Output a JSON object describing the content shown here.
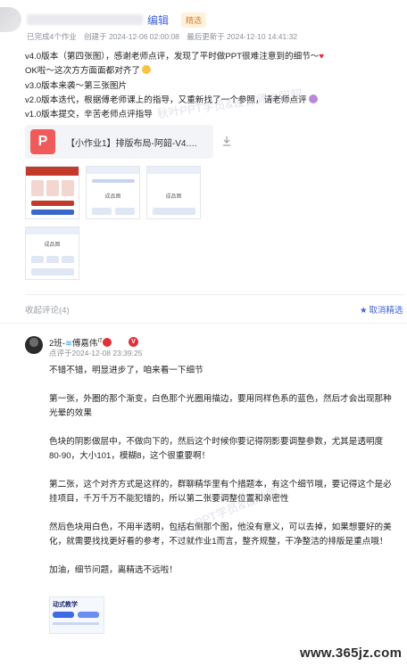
{
  "post": {
    "edit_label": "编辑",
    "featured_badge": "精选",
    "meta": {
      "works_count": "已完成4个作业",
      "created": "创建于 2024-12-06 02:00:08",
      "updated": "最后更新于 2024-12-10 14:41:32"
    },
    "changelog": [
      "v4.0版本（第四张图），感谢老师点评，发现了平时做PPT很难注意到的细节～",
      "OK啦～这次方方面面都对齐了",
      "v3.0版本来袭～第三张图片",
      "v2.0版本迭代，根据傅老师课上的指导，又重新找了一个参照，请老师点评",
      "v1.0版本提交，辛苦老师点评指导"
    ],
    "attachment": {
      "icon": "ppt-file-icon",
      "icon_letter": "P",
      "filename": "【小作业1】排版布局-阿韶-V4.0...."
    },
    "thumbnails": [
      "成品图",
      "成品图",
      "成品图"
    ],
    "watermark": "秋叶PPT学员&设计师@阿韶"
  },
  "comments": {
    "label": "收起评论(4)",
    "unstar_label": "取消精选",
    "items": [
      {
        "author": "2班-",
        "author_suffix": "傅嘉伟",
        "author_tag": "IT",
        "badge": "V",
        "time": "点评于2024-12-08 23:39:25",
        "paragraphs": [
          "不错不错，明显进步了，咱来看一下细节",
          "第一张，外圈的那个渐变，白色那个光圈用描边，要用同样色系的蓝色，然后才会出现那种光晕的效果",
          "色块的阴影做层中，不做向下的，然后这个时候你要记得阴影要调整参数，尤其是透明度80-90，大小101，模糊8，这个很重要啊！",
          "第二张，这个对齐方式是这样的，群聊精华里有个措题本，有这个细节哦，要记得这个是必挂项目，千万千万不能犯错的，所以第二张要调整位置和亲密性",
          "然后色块用白色，不用半透明，包括右侧那个图，他没有意义，可以去掉，如果想要好的美化，就需要找找更好看的参考，不过就作业1而言，整齐规整，干净整洁的排版是重点哦！",
          "加油，细节问题，离精选不远啦！"
        ],
        "attachment_title": "动式教学",
        "watermark": "秋叶PPT学员&设计师"
      }
    ]
  },
  "site_watermark": "www.365jz.com",
  "colors": {
    "link": "#3e63dd",
    "badge_orange": "#d9822b",
    "ppt_red": "#f05a5a",
    "meta_gray": "#8a8f99"
  }
}
